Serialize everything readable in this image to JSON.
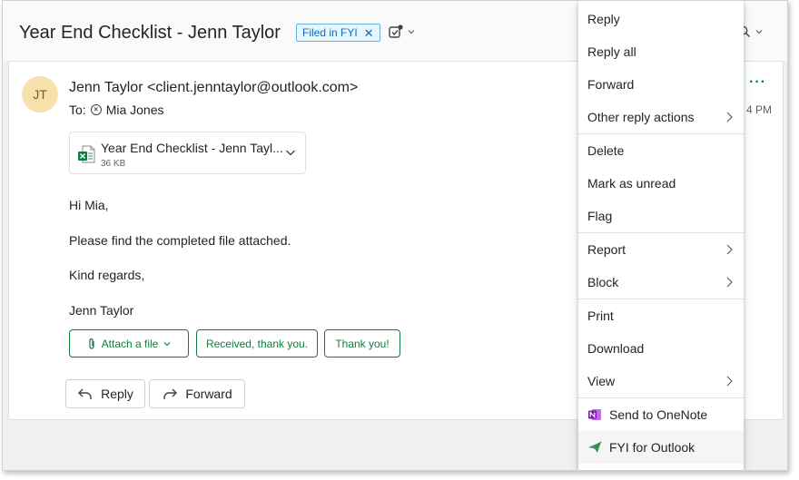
{
  "header": {
    "subject": "Year End Checklist - Jenn Taylor",
    "category_tag": "Filed in FYI",
    "tag_remove": "✕"
  },
  "message": {
    "avatar_initials": "JT",
    "from": "Jenn Taylor <client.jenntaylor@outlook.com>",
    "to_label": "To:",
    "to_recipient": "Mia Jones",
    "more_dots": "···",
    "time_fragment": "4 PM",
    "attachment": {
      "name": "Year End Checklist - Jenn Tayl...",
      "size": "36 KB"
    },
    "body": {
      "greeting": "Hi Mia,",
      "line1": "Please find the completed file attached.",
      "closing": "Kind regards,",
      "signature": "Jenn Taylor"
    },
    "quick_replies": {
      "attach": "Attach a file",
      "received": "Received, thank you.",
      "thanks": "Thank you!"
    },
    "actions": {
      "reply": "Reply",
      "forward": "Forward"
    }
  },
  "menu": {
    "reply": "Reply",
    "reply_all": "Reply all",
    "forward": "Forward",
    "other_reply": "Other reply actions",
    "delete": "Delete",
    "mark_unread": "Mark as unread",
    "flag": "Flag",
    "report": "Report",
    "block": "Block",
    "print": "Print",
    "download": "Download",
    "view": "View",
    "send_onenote": "Send to OneNote",
    "fyi_outlook": "FYI for Outlook"
  },
  "colors": {
    "accent_green": "#107c41",
    "tag_blue": "#0f6cbd",
    "avatar_bg": "#f7e2ad",
    "onenote_purple": "#7719aa",
    "fyi_green": "#3a9a5b"
  }
}
